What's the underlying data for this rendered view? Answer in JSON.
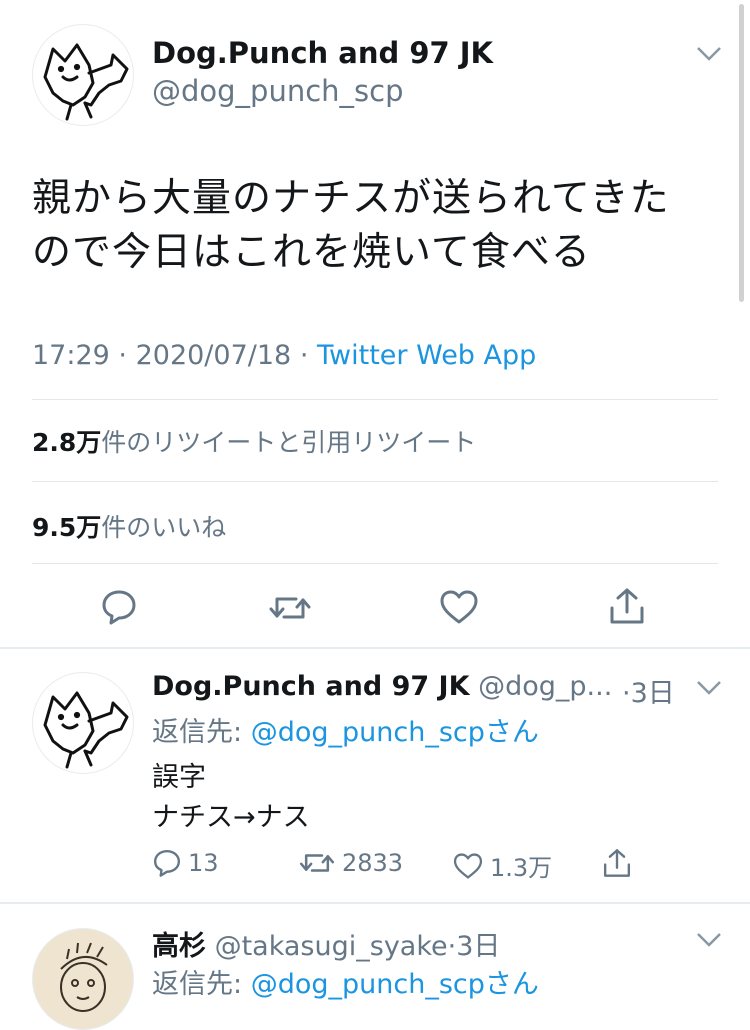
{
  "main_tweet": {
    "display_name": "Dog.Punch and 97 JK",
    "handle": "@dog_punch_scp",
    "text_line1": "親から大量のナチスが送られてきた",
    "text_line2": "ので今日はこれを焼いて食べる",
    "time": "17:29",
    "sep1": "·",
    "date": "2020/07/18",
    "sep2": "·",
    "source": "Twitter Web App",
    "retweets_count": "2.8万",
    "retweets_label": "件のリツイートと引用リツイート",
    "likes_count": "9.5万",
    "likes_label": "件のいいね"
  },
  "reply1": {
    "display_name": "Dog.Punch and 97 JK",
    "handle": "@dog_p...",
    "time": "·3日",
    "reply_prefix": "返信先:",
    "reply_to": "@dog_punch_scpさん",
    "text_line1": "誤字",
    "text_line2": "ナチス→ナス",
    "reply_count": "13",
    "retweet_count": "2833",
    "like_count": "1.3万"
  },
  "reply2": {
    "display_name": "高杉",
    "handle": "@takasugi_syake",
    "time": "·3日",
    "reply_prefix": "返信先:",
    "reply_to": "@dog_punch_scpさん"
  },
  "colors": {
    "text": "#14171a",
    "muted": "#657786",
    "link": "#1b95e0",
    "divider": "#e1e8ed"
  },
  "icons": [
    "chevron-down-icon",
    "reply-icon",
    "retweet-icon",
    "like-icon",
    "share-icon"
  ]
}
